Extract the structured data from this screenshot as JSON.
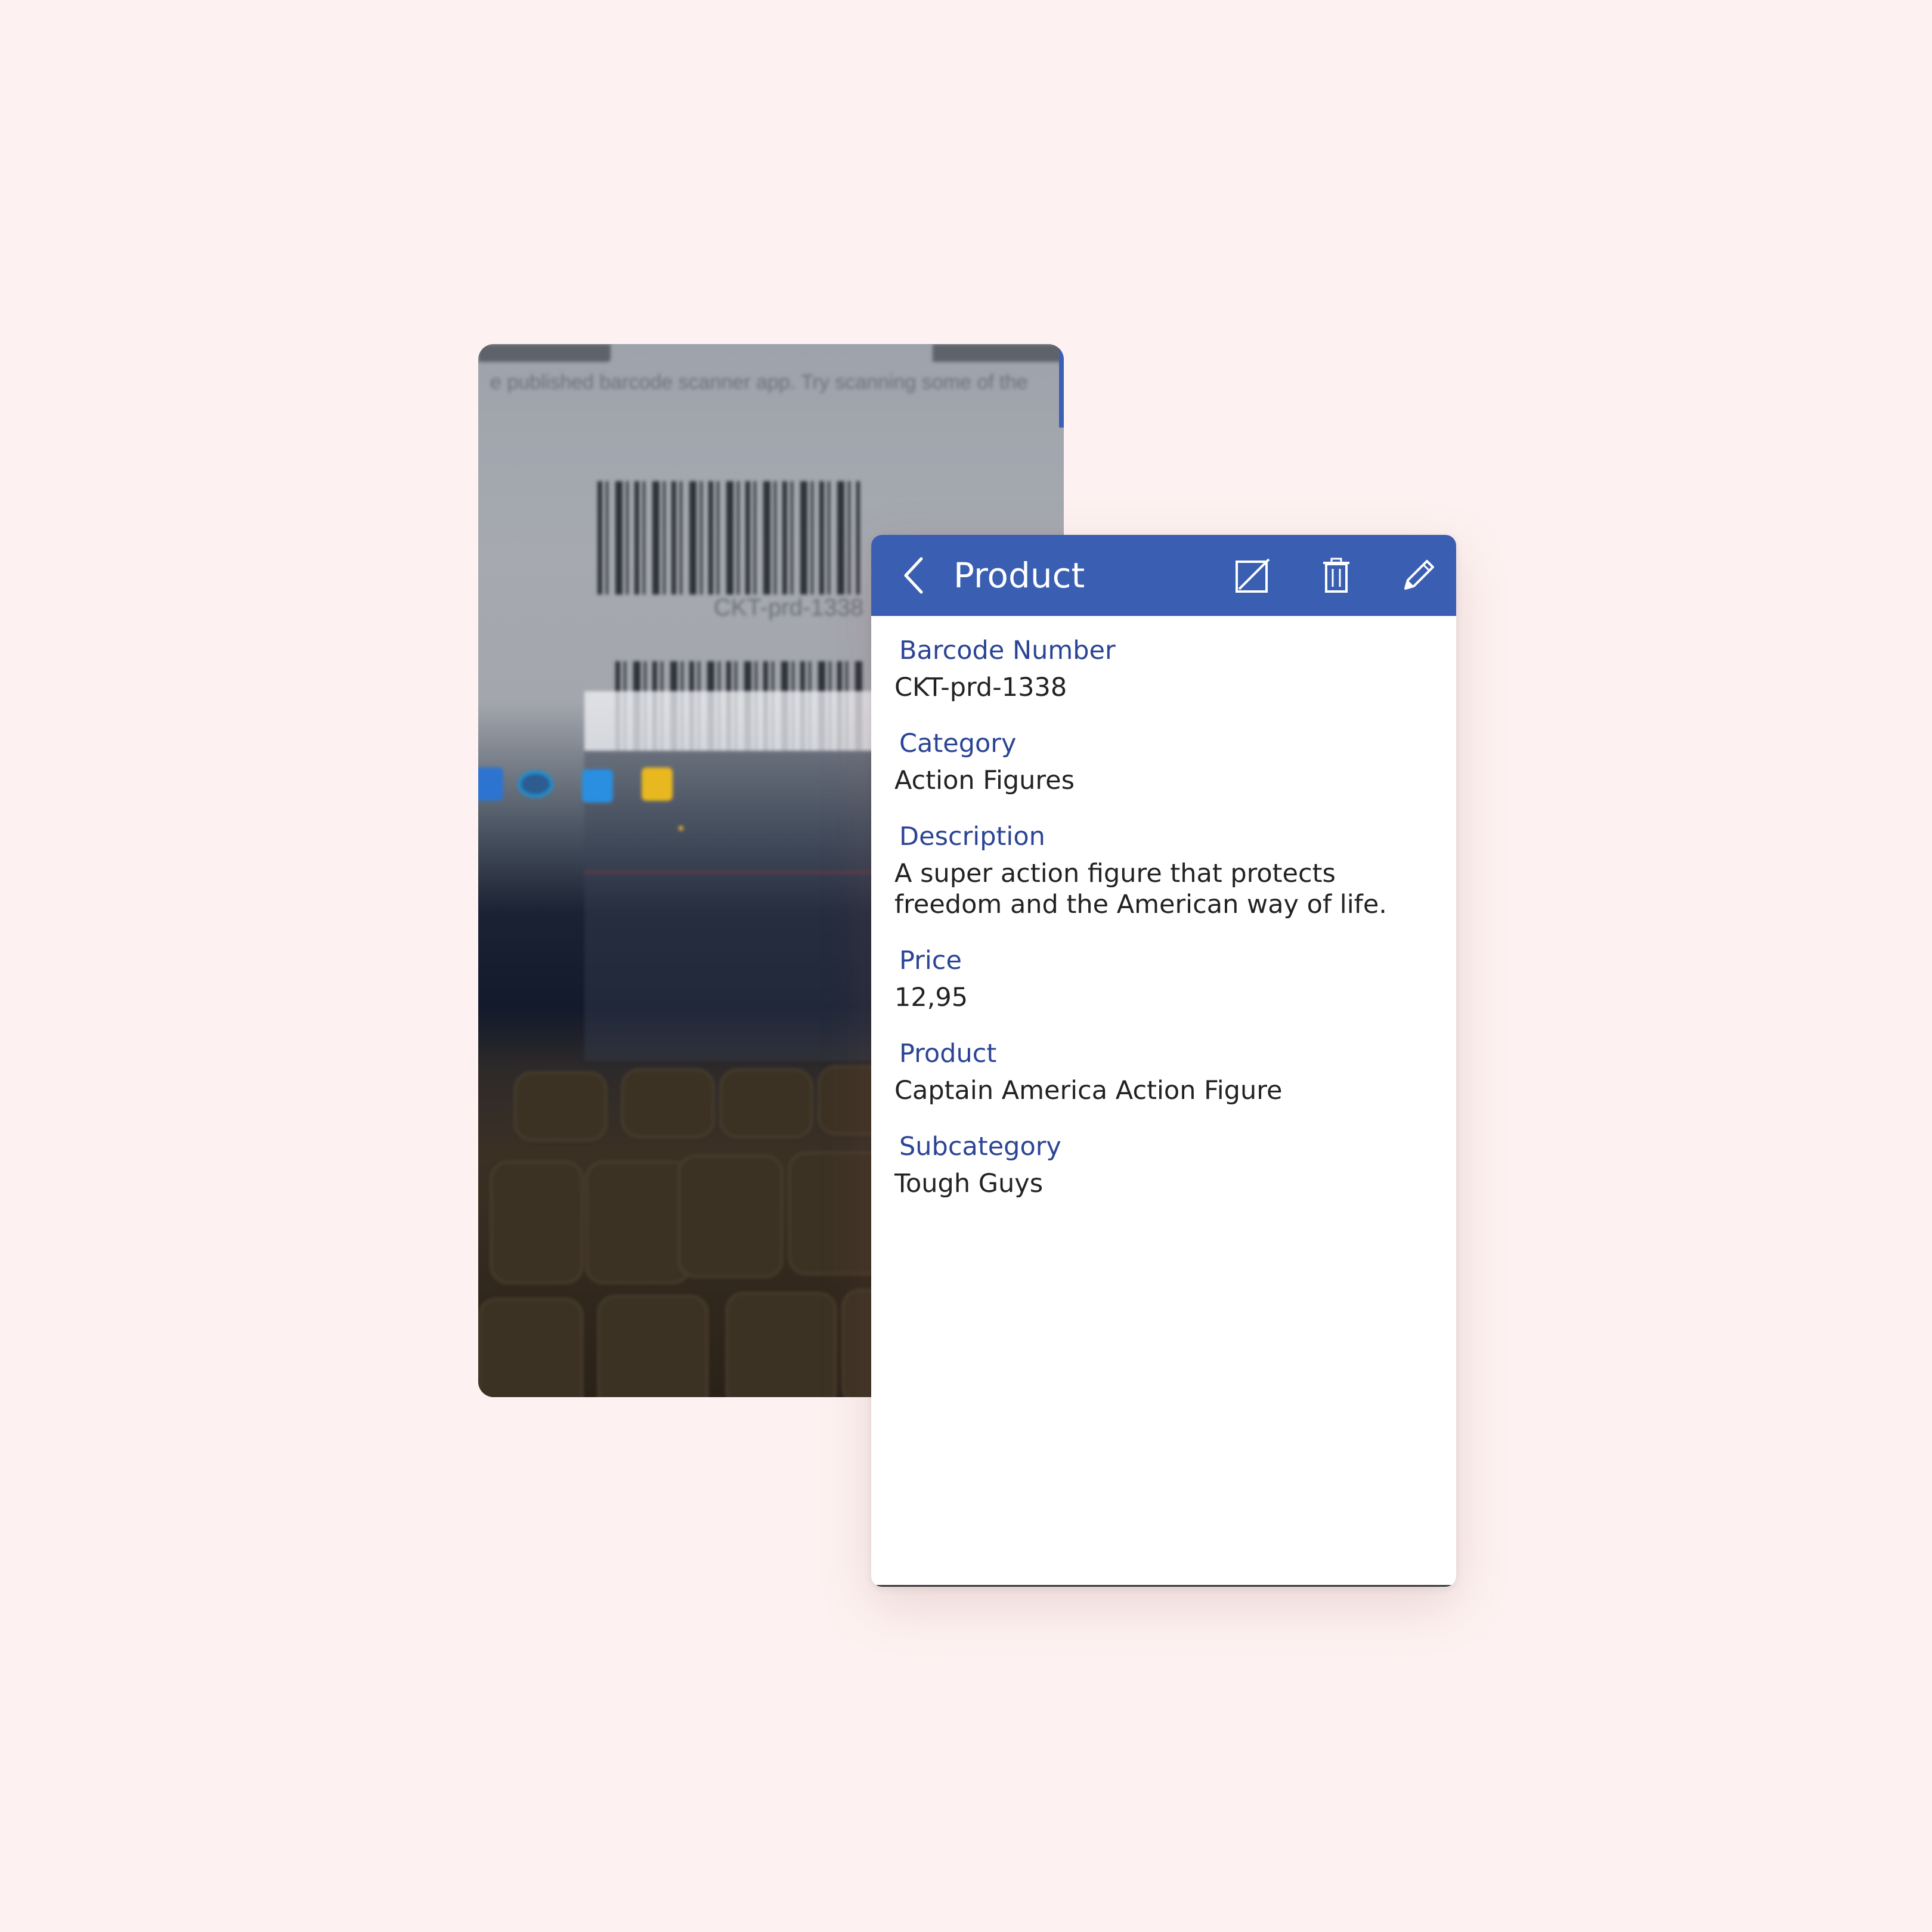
{
  "camera": {
    "background_text": "e published barcode scanner app. Try scanning some of the",
    "barcode_caption": "CKT-prd-1338"
  },
  "header": {
    "title": "Product",
    "color": "#3a5fb2",
    "icons": [
      "chevron-left-icon",
      "edit-box-icon",
      "trash-icon",
      "pencil-icon"
    ]
  },
  "fields": [
    {
      "label": "Barcode Number",
      "value": "CKT-prd-1338"
    },
    {
      "label": "Category",
      "value": "Action Figures"
    },
    {
      "label": "Description",
      "value": "A super action figure that protects freedom and the American way of life."
    },
    {
      "label": "Price",
      "value": "12,95"
    },
    {
      "label": "Product",
      "value": "Captain America Action Figure"
    },
    {
      "label": "Subcategory",
      "value": "Tough Guys"
    }
  ],
  "colors": {
    "label": "#2b4496",
    "value": "#222222",
    "page_background": "#fdf2f1"
  }
}
